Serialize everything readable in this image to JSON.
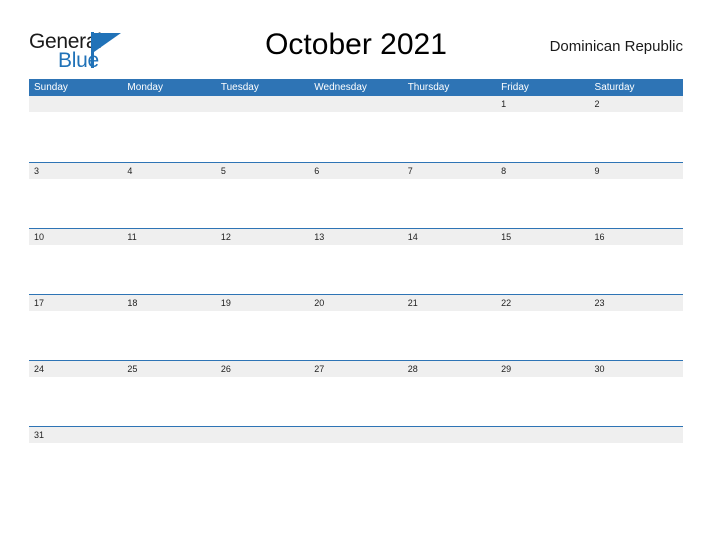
{
  "brand": {
    "word_one": "General",
    "word_two": "Blue",
    "mark": "triangle-logo-mark",
    "colors": {
      "blue": "#2072b8",
      "dark": "#1a1a1a"
    }
  },
  "header": {
    "title": "October 2021",
    "month": "October",
    "year": "2021",
    "country": "Dominican Republic"
  },
  "theme": {
    "header_blue": "#2e74b5",
    "row_gray": "#efefef",
    "separator_blue": "#2e74b5",
    "page_background": "#ffffff",
    "date_text": "#222222",
    "weekday_text": "#ffffff"
  },
  "calendar": {
    "weekdays": [
      "Sunday",
      "Monday",
      "Tuesday",
      "Wednesday",
      "Thursday",
      "Friday",
      "Saturday"
    ],
    "weeks": [
      [
        "",
        "",
        "",
        "",
        "",
        "1",
        "2"
      ],
      [
        "3",
        "4",
        "5",
        "6",
        "7",
        "8",
        "9"
      ],
      [
        "10",
        "11",
        "12",
        "13",
        "14",
        "15",
        "16"
      ],
      [
        "17",
        "18",
        "19",
        "20",
        "21",
        "22",
        "23"
      ],
      [
        "24",
        "25",
        "26",
        "27",
        "28",
        "29",
        "30"
      ],
      [
        "31",
        "",
        "",
        "",
        "",
        "",
        ""
      ]
    ]
  }
}
